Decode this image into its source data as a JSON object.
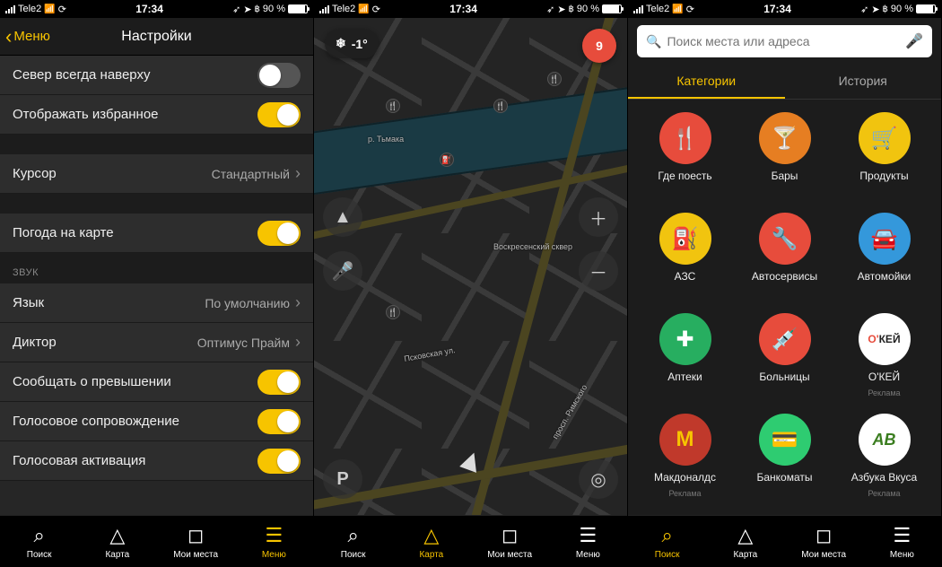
{
  "status": {
    "carrier": "Tele2",
    "time": "17:34",
    "battery_pct": "90 %"
  },
  "screen1": {
    "back_label": "Меню",
    "title": "Настройки",
    "rows": {
      "north_up": "Север всегда наверху",
      "show_fav": "Отображать избранное",
      "cursor": "Курсор",
      "cursor_val": "Стандартный",
      "weather": "Погода на карте",
      "sound_section": "ЗВУК",
      "language": "Язык",
      "language_val": "По умолчанию",
      "announcer": "Диктор",
      "announcer_val": "Оптимус Прайм",
      "speed_warn": "Сообщать о превышении",
      "voice_guide": "Голосовое сопровождение",
      "voice_activate": "Голосовая активация"
    }
  },
  "screen2": {
    "temp": "-1°",
    "alert_count": "9",
    "park_label": "P",
    "labels": {
      "sq": "Воскресенский сквер",
      "river": "р. Тьмака",
      "prosp": "просп. Римского",
      "pskov": "Псковская ул."
    }
  },
  "screen3": {
    "search_placeholder": "Поиск места или адреса",
    "tab_cat": "Категории",
    "tab_hist": "История",
    "ad_label": "Реклама",
    "cats": {
      "eat": "Где поесть",
      "bars": "Бары",
      "grocery": "Продукты",
      "fuel": "АЗС",
      "service": "Автосервисы",
      "wash": "Автомойки",
      "pharm": "Аптеки",
      "hosp": "Больницы",
      "okey": "О'КЕЙ",
      "mcd": "Макдоналдс",
      "atm": "Банкоматы",
      "azbuka": "Азбука Вкуса"
    }
  },
  "tabs": {
    "search": "Поиск",
    "map": "Карта",
    "places": "Мои места",
    "menu": "Меню"
  }
}
